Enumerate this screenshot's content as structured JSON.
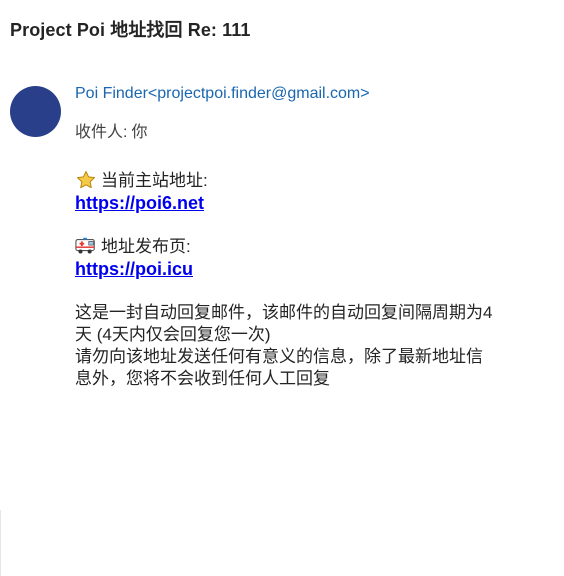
{
  "email": {
    "subject": "Project Poi 地址找回 Re: 111",
    "sender": "Poi Finder<projectpoi.finder@gmail.com>",
    "recipient_label": "收件人:",
    "recipient_value": "你",
    "body": {
      "main_site_label": "当前主站地址:",
      "main_site_link": "https://poi6.net",
      "publish_page_label": "地址发布页:",
      "publish_page_link": "https://poi.icu",
      "notice_line1": "这是一封自动回复邮件，该邮件的自动回复间隔周期为4",
      "notice_line2": "天 (4天内仅会回复您一次)",
      "notice_line3": "请勿向该地址发送任何有意义的信息，除了最新地址信",
      "notice_line4": "息外，您将不会收到任何人工回复"
    }
  },
  "icons": {
    "main_site": "star-icon",
    "publish_page": "ambulance-icon"
  },
  "colors": {
    "avatar": "#2a3f8a",
    "sender": "#1a66b0",
    "link": "#0000ee"
  }
}
